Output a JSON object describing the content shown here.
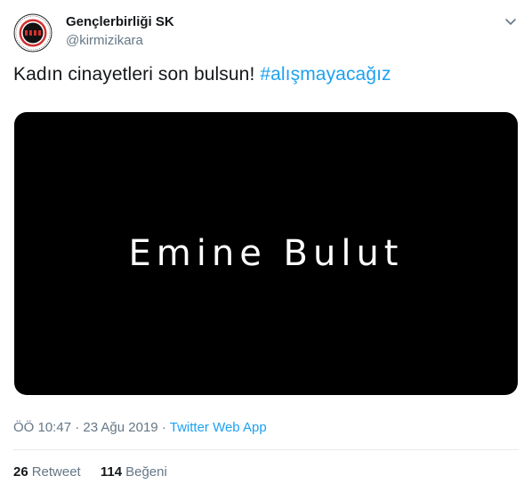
{
  "user": {
    "name": "Gençlerbirliği SK",
    "handle": "@kirmizikara",
    "avatar_icon": "club-crest-logo",
    "avatar_colors": {
      "ring": "#d32f2f",
      "center": "#111111"
    }
  },
  "tweet": {
    "text": "Kadın cinayetleri son bulsun!",
    "hashtag": "#alışmayacağız"
  },
  "media": {
    "title_text": "Emine Bulut"
  },
  "meta": {
    "time": "ÖÖ 10:47",
    "separator1": "·",
    "date": "23 Ağu 2019",
    "separator2": "·",
    "app": "Twitter Web App"
  },
  "stats": {
    "retweets_count": "26",
    "retweets_label": "Retweet",
    "likes_count": "114",
    "likes_label": "Beğeni"
  },
  "colors": {
    "link": "#1da1f2",
    "secondary_text": "#657786",
    "primary_text": "#14171a"
  }
}
